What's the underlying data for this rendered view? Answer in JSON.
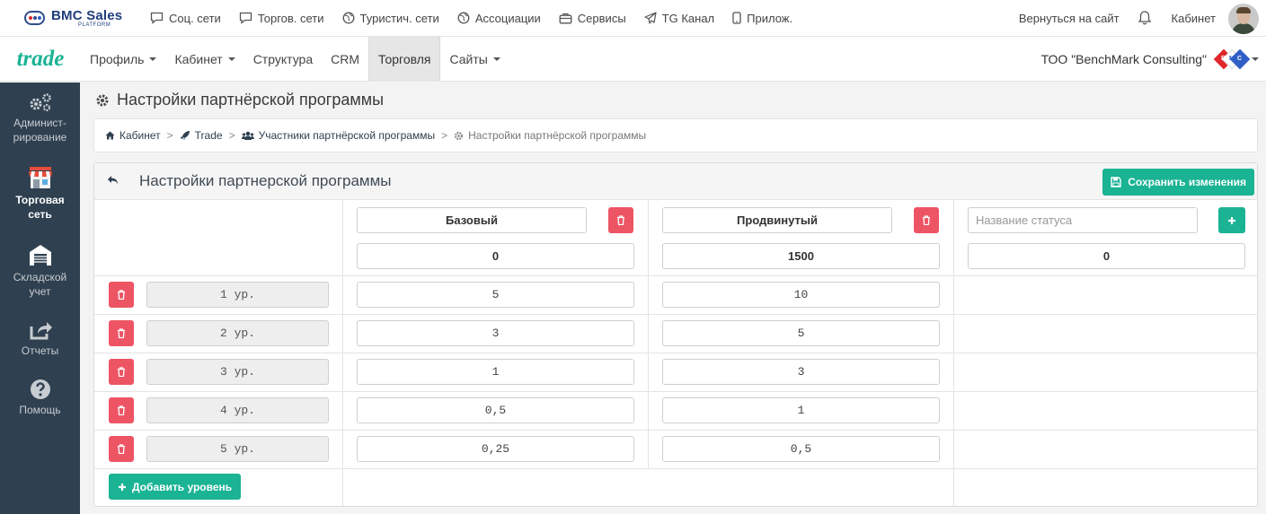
{
  "topbar": {
    "brand_name": "BMC Sales",
    "brand_sub": "PLATFORM",
    "links": [
      {
        "label": "Соц. сети",
        "icon": "chat-icon"
      },
      {
        "label": "Торгов. сети",
        "icon": "chat-square-icon"
      },
      {
        "label": "Туристич. сети",
        "icon": "globe-icon"
      },
      {
        "label": "Ассоциации",
        "icon": "globe-icon"
      },
      {
        "label": "Сервисы",
        "icon": "briefcase-icon"
      },
      {
        "label": "TG Канал",
        "icon": "send-icon"
      },
      {
        "label": "Прилож.",
        "icon": "phone-icon"
      }
    ],
    "back_to_site": "Вернуться на сайт",
    "cabinet": "Кабинет"
  },
  "navbar": {
    "logo": "trade",
    "items": [
      {
        "label": "Профиль",
        "dropdown": true
      },
      {
        "label": "Кабинет",
        "dropdown": true
      },
      {
        "label": "Структура",
        "dropdown": false
      },
      {
        "label": "CRM",
        "dropdown": false
      },
      {
        "label": "Торговля",
        "dropdown": false,
        "active": true
      },
      {
        "label": "Сайты",
        "dropdown": true
      }
    ],
    "company": "ТОО \"BenchMark Consulting\"",
    "company_logo": [
      "B",
      "M",
      "C"
    ]
  },
  "sidebar": {
    "items": [
      {
        "label": "Админист-рирование",
        "icon": "gears-icon"
      },
      {
        "label": "Торговая сеть",
        "icon": "store-icon",
        "active": true
      },
      {
        "label": "Складской учет",
        "icon": "warehouse-icon"
      },
      {
        "label": "Отчеты",
        "icon": "share-icon"
      },
      {
        "label": "Помощь",
        "icon": "help-icon"
      }
    ]
  },
  "page": {
    "title": "Настройки партнёрской программы"
  },
  "breadcrumb": [
    {
      "label": "Кабинет",
      "icon": "home-icon"
    },
    {
      "label": "Trade",
      "icon": "rocket-icon"
    },
    {
      "label": "Участники партнёрской программы",
      "icon": "users-icon"
    },
    {
      "label": "Настройки партнёрской программы",
      "icon": "gear-icon"
    }
  ],
  "panel": {
    "title": "Настройки партнерской программы",
    "save_label": "Сохранить изменения",
    "add_level_label": "Добавить уровень",
    "statuses": [
      {
        "name": "Базовый",
        "threshold": "0"
      },
      {
        "name": "Продвинутый",
        "threshold": "1500"
      }
    ],
    "new_status": {
      "name_placeholder": "Название статуса",
      "threshold": "0"
    },
    "levels": [
      {
        "label": "1 ур.",
        "values": [
          "5",
          "10"
        ]
      },
      {
        "label": "2 ур.",
        "values": [
          "3",
          "5"
        ]
      },
      {
        "label": "3 ур.",
        "values": [
          "1",
          "3"
        ]
      },
      {
        "label": "4 ур.",
        "values": [
          "0,5",
          "1"
        ]
      },
      {
        "label": "5 ур.",
        "values": [
          "0,25",
          "0,5"
        ]
      }
    ]
  },
  "colors": {
    "accent": "#1ab394",
    "danger": "#ed5565",
    "sidebar": "#2f4050"
  }
}
